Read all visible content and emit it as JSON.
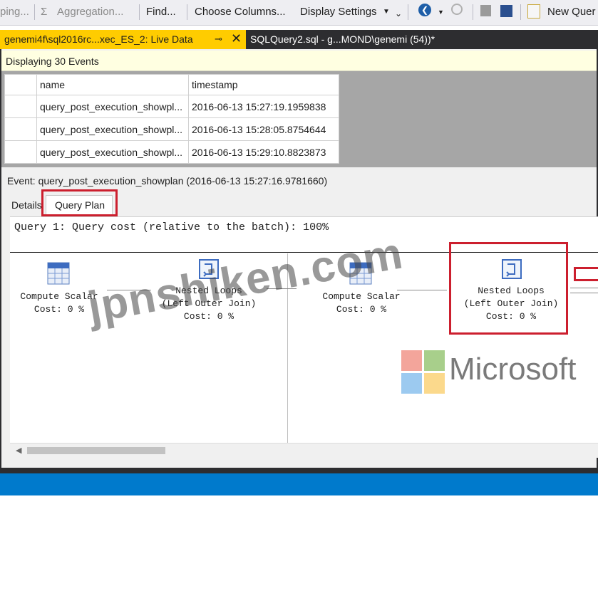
{
  "toolbar": {
    "grouping_label": "ping...",
    "aggregation_label": "Aggregation...",
    "find_label": "Find...",
    "choose_columns_label": "Choose Columns...",
    "display_settings_label": "Display Settings",
    "new_query_label": "New Quer"
  },
  "tabs": {
    "live_data_title": "genemi4f\\sql2016rc...xec_ES_2: Live Data",
    "sql_title": "SQLQuery2.sql - g...MOND\\genemi (54))*"
  },
  "live_data": {
    "status": "Displaying 30 Events",
    "columns": [
      "",
      "name",
      "timestamp"
    ],
    "rows": [
      {
        "name": "query_post_execution_showpl...",
        "timestamp": "2016-06-13 15:27:19.1959838"
      },
      {
        "name": "query_post_execution_showpl...",
        "timestamp": "2016-06-13 15:28:05.8754644"
      },
      {
        "name": "query_post_execution_showpl...",
        "timestamp": "2016-06-13 15:29:10.8823873"
      }
    ],
    "event_title": "Event: query_post_execution_showplan (2016-06-13 15:27:16.9781660)"
  },
  "detail_tabs": {
    "details_label": "Details",
    "query_plan_label": "Query Plan"
  },
  "plan": {
    "header": "Query 1: Query cost (relative to the batch): 100%",
    "operators": [
      {
        "line1": "Compute Scalar",
        "line2": "Cost: 0 %"
      },
      {
        "line0": "Nested Loops",
        "line1": "(Left Outer Join)",
        "line2": "Cost: 0 %"
      },
      {
        "line1": "Compute Scalar",
        "line2": "Cost: 0 %"
      },
      {
        "line0": "Nested Loops",
        "line1": "(Left Outer Join)",
        "line2": "Cost: 0 %"
      }
    ]
  },
  "overlay": {
    "watermark": "jpnshiken.com",
    "brand": "Microsoft"
  },
  "colors": {
    "accent_tab": "#ffcc00",
    "highlight": "#cc1f2e",
    "status_bar": "#007acc"
  }
}
